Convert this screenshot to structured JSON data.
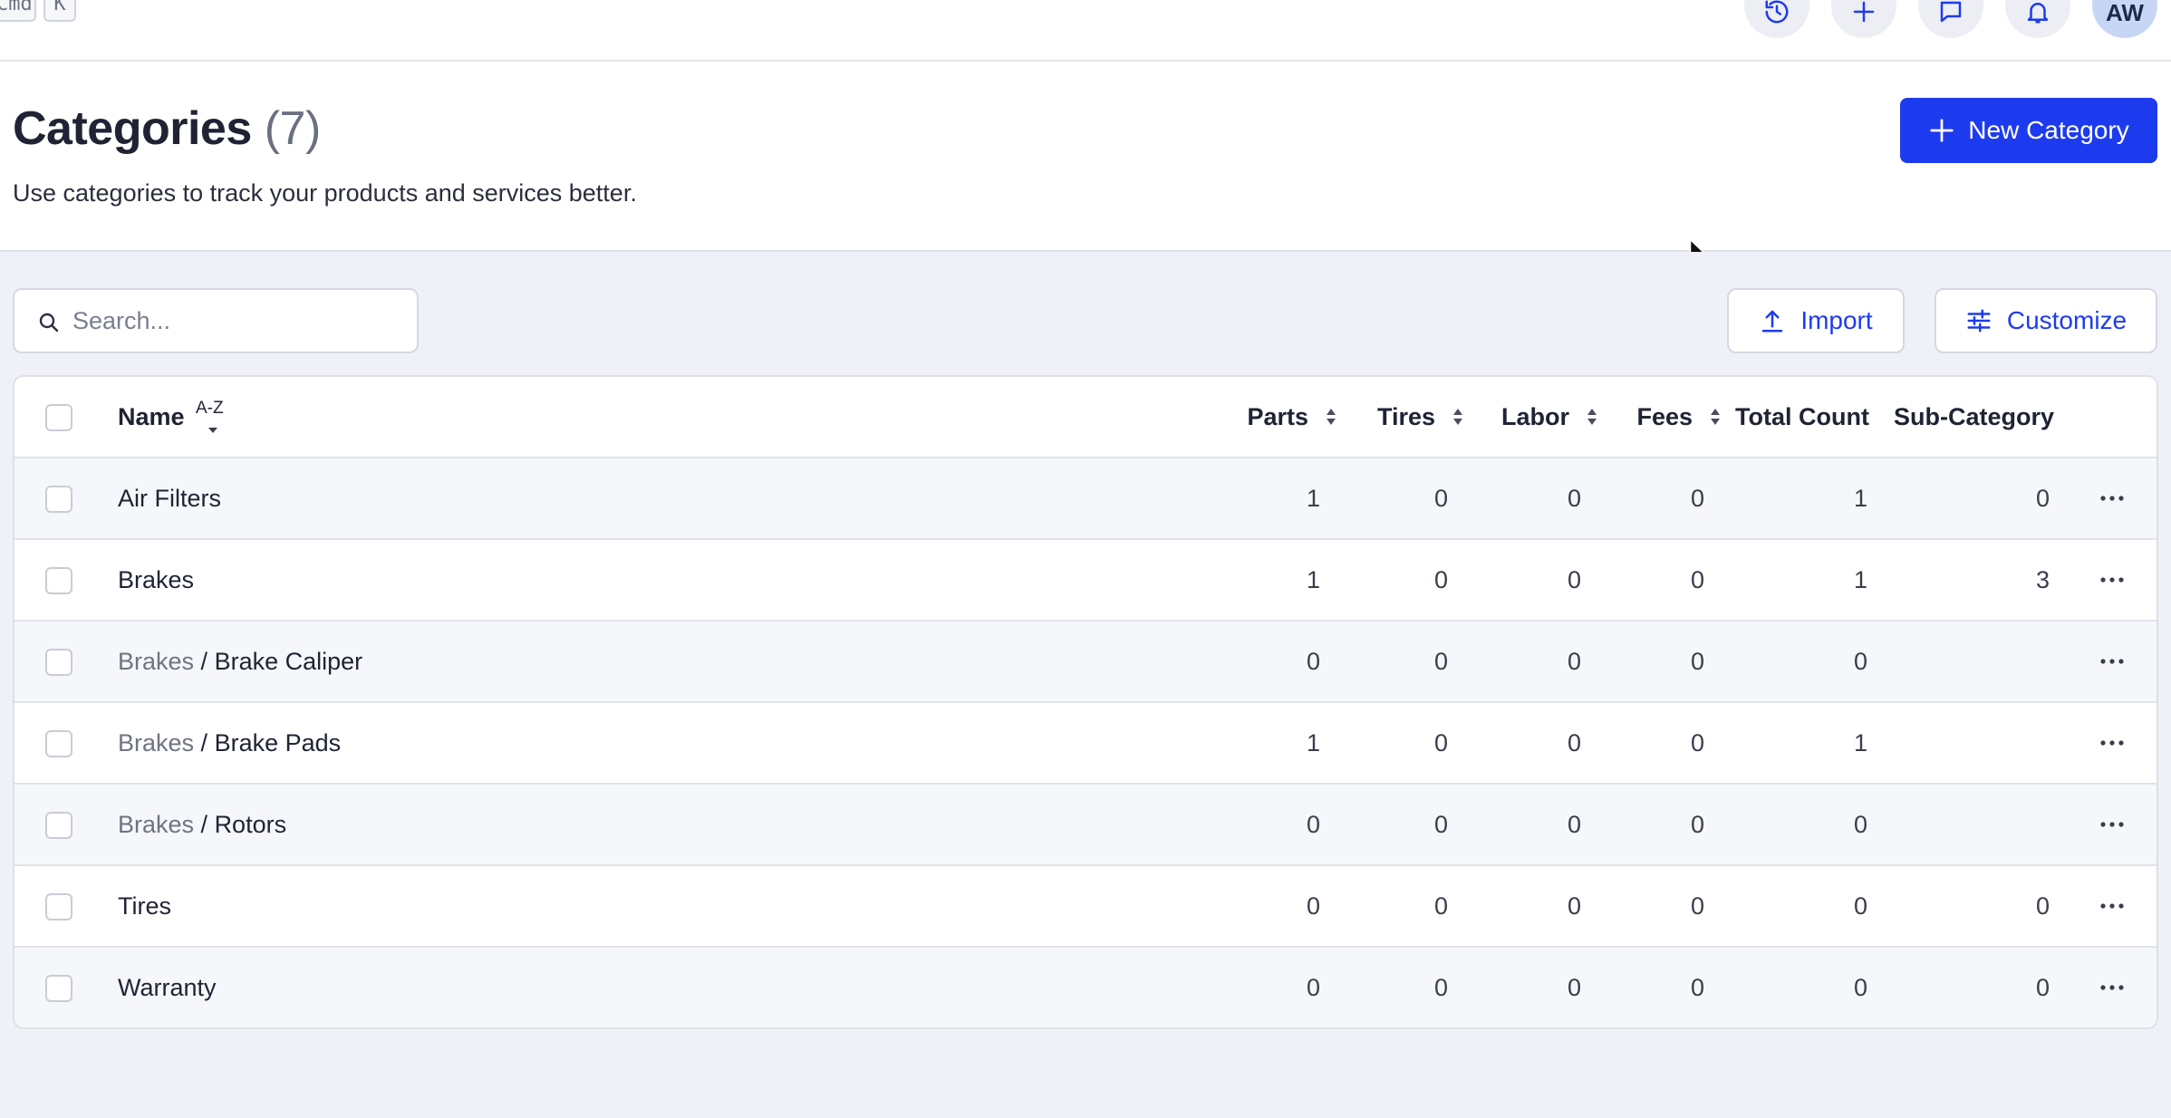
{
  "topbar": {
    "kbd_cmd": "Cmd",
    "kbd_k": "K",
    "avatar": "AW",
    "icons": [
      "history-icon",
      "plus-icon",
      "chat-icon",
      "bell-icon"
    ]
  },
  "header": {
    "title": "Categories",
    "count": "(7)",
    "subtitle": "Use categories to track your products and services better.",
    "new_button": "New Category"
  },
  "toolbar": {
    "search_placeholder": "Search...",
    "import_label": "Import",
    "customize_label": "Customize"
  },
  "table": {
    "columns": {
      "name": "Name",
      "name_sort": "A-Z",
      "parts": "Parts",
      "tires": "Tires",
      "labor": "Labor",
      "fees": "Fees",
      "total": "Total Count",
      "sub": "Sub-Category"
    },
    "rows": [
      {
        "parent": "",
        "name": "Air Filters",
        "parts": "1",
        "tires": "0",
        "labor": "0",
        "fees": "0",
        "total": "1",
        "sub": "0"
      },
      {
        "parent": "",
        "name": "Brakes",
        "parts": "1",
        "tires": "0",
        "labor": "0",
        "fees": "0",
        "total": "1",
        "sub": "3"
      },
      {
        "parent": "Brakes",
        "name": "Brake Caliper",
        "parts": "0",
        "tires": "0",
        "labor": "0",
        "fees": "0",
        "total": "0",
        "sub": ""
      },
      {
        "parent": "Brakes",
        "name": "Brake Pads",
        "parts": "1",
        "tires": "0",
        "labor": "0",
        "fees": "0",
        "total": "1",
        "sub": ""
      },
      {
        "parent": "Brakes",
        "name": "Rotors",
        "parts": "0",
        "tires": "0",
        "labor": "0",
        "fees": "0",
        "total": "0",
        "sub": ""
      },
      {
        "parent": "",
        "name": "Tires",
        "parts": "0",
        "tires": "0",
        "labor": "0",
        "fees": "0",
        "total": "0",
        "sub": "0"
      },
      {
        "parent": "",
        "name": "Warranty",
        "parts": "0",
        "tires": "0",
        "labor": "0",
        "fees": "0",
        "total": "0",
        "sub": "0"
      }
    ]
  },
  "colors": {
    "accent": "#1d3bee",
    "content_bg": "#f0f1f8",
    "row_alt": "#f6f7fa"
  }
}
